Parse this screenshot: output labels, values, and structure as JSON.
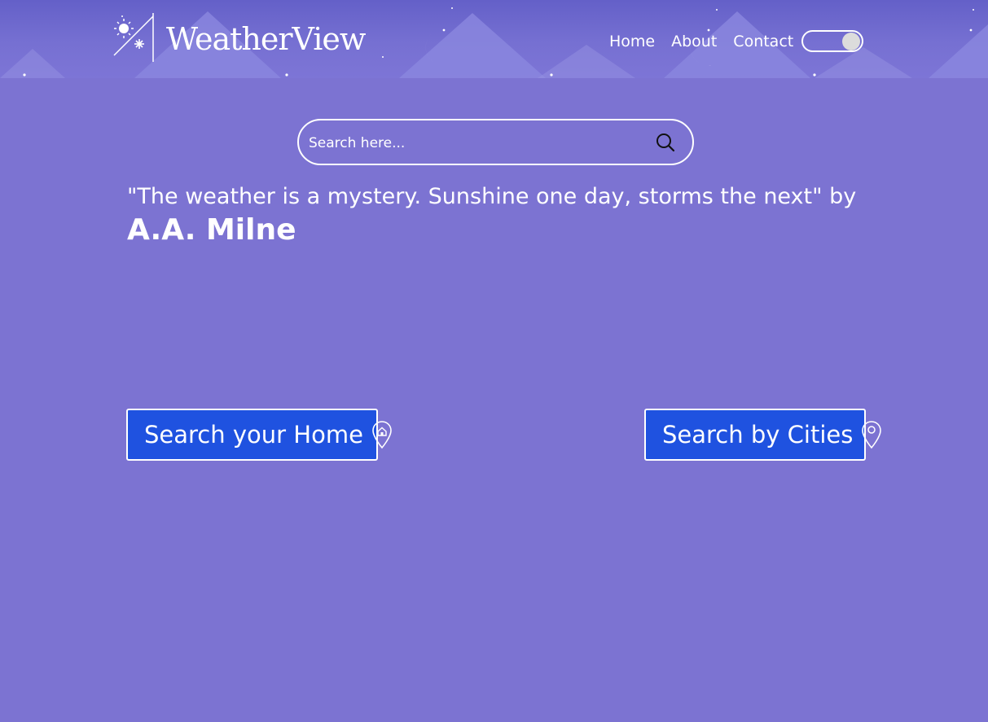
{
  "header": {
    "logo_text": "WeatherView",
    "logo_icon": "weather-logo-icon",
    "background": "night-sky-moons-mountains"
  },
  "nav": {
    "items": [
      {
        "label": "Home"
      },
      {
        "label": "About"
      },
      {
        "label": "Contact"
      }
    ],
    "theme_toggle": {
      "state": "on"
    }
  },
  "search": {
    "placeholder": "Search here...",
    "icon": "search-icon"
  },
  "quote": {
    "text": "\"The weather is a mystery. Sunshine one day, storms the next\" by",
    "author": "A.A. Milne"
  },
  "actions": {
    "home_label": "Search your Home",
    "home_icon": "home-pin-icon",
    "cities_label": "Search by Cities",
    "cities_icon": "location-pin-icon"
  },
  "colors": {
    "background": "#7c73d2",
    "button": "#1f52e0",
    "text": "#ffffff"
  }
}
